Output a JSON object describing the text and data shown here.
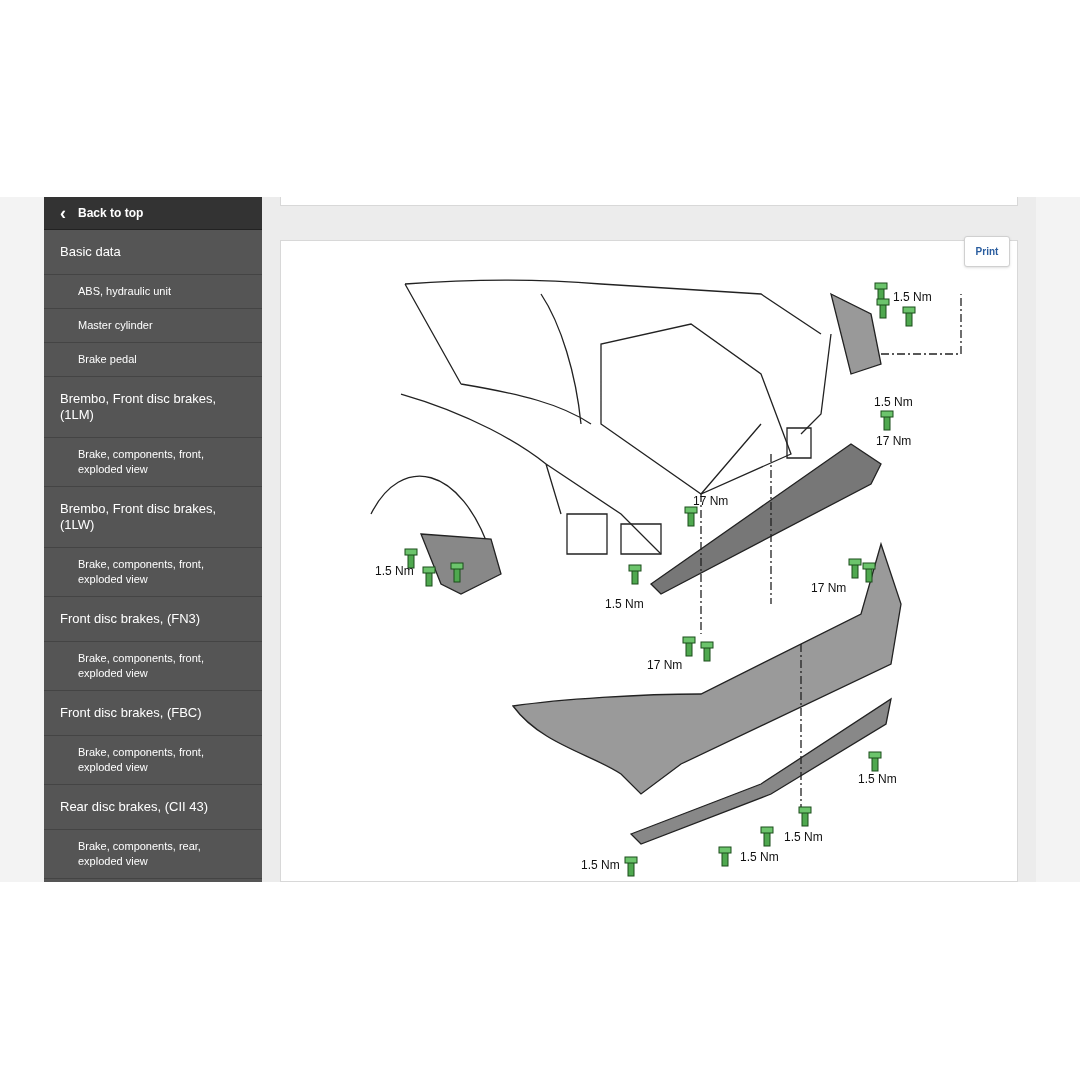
{
  "sidebar": {
    "back_link": {
      "icon": "‹",
      "label": "Back to top"
    },
    "items": [
      {
        "kind": "section",
        "label": "Basic data"
      },
      {
        "kind": "sub",
        "label": "ABS, hydraulic unit"
      },
      {
        "kind": "sub",
        "label": "Master cylinder"
      },
      {
        "kind": "sub",
        "label": "Brake pedal"
      },
      {
        "kind": "section",
        "label": "Brembo, Front disc brakes, (1LM)"
      },
      {
        "kind": "sub",
        "label": "Brake, components, front, exploded view"
      },
      {
        "kind": "section",
        "label": "Brembo, Front disc brakes, (1LW)"
      },
      {
        "kind": "sub",
        "label": "Brake, components, front, exploded view"
      },
      {
        "kind": "section",
        "label": "Front disc brakes, (FN3)"
      },
      {
        "kind": "sub",
        "label": "Brake, components, front, exploded view"
      },
      {
        "kind": "section",
        "label": "Front disc brakes, (FBC)"
      },
      {
        "kind": "sub",
        "label": "Brake, components, front, exploded view"
      },
      {
        "kind": "section",
        "label": "Rear disc brakes, (CII 43)"
      },
      {
        "kind": "sub",
        "label": "Brake, components, rear, exploded view"
      }
    ]
  },
  "diagram": {
    "print_button": "Print",
    "torque_labels": [
      "1.5 Nm",
      "1.5 Nm",
      "17 Nm",
      "17 Nm",
      "1.5 Nm",
      "1.5 Nm",
      "17 Nm",
      "17 Nm",
      "1.5 Nm",
      "1.5 Nm",
      "1.5 Nm",
      "1.5 Nm"
    ]
  }
}
